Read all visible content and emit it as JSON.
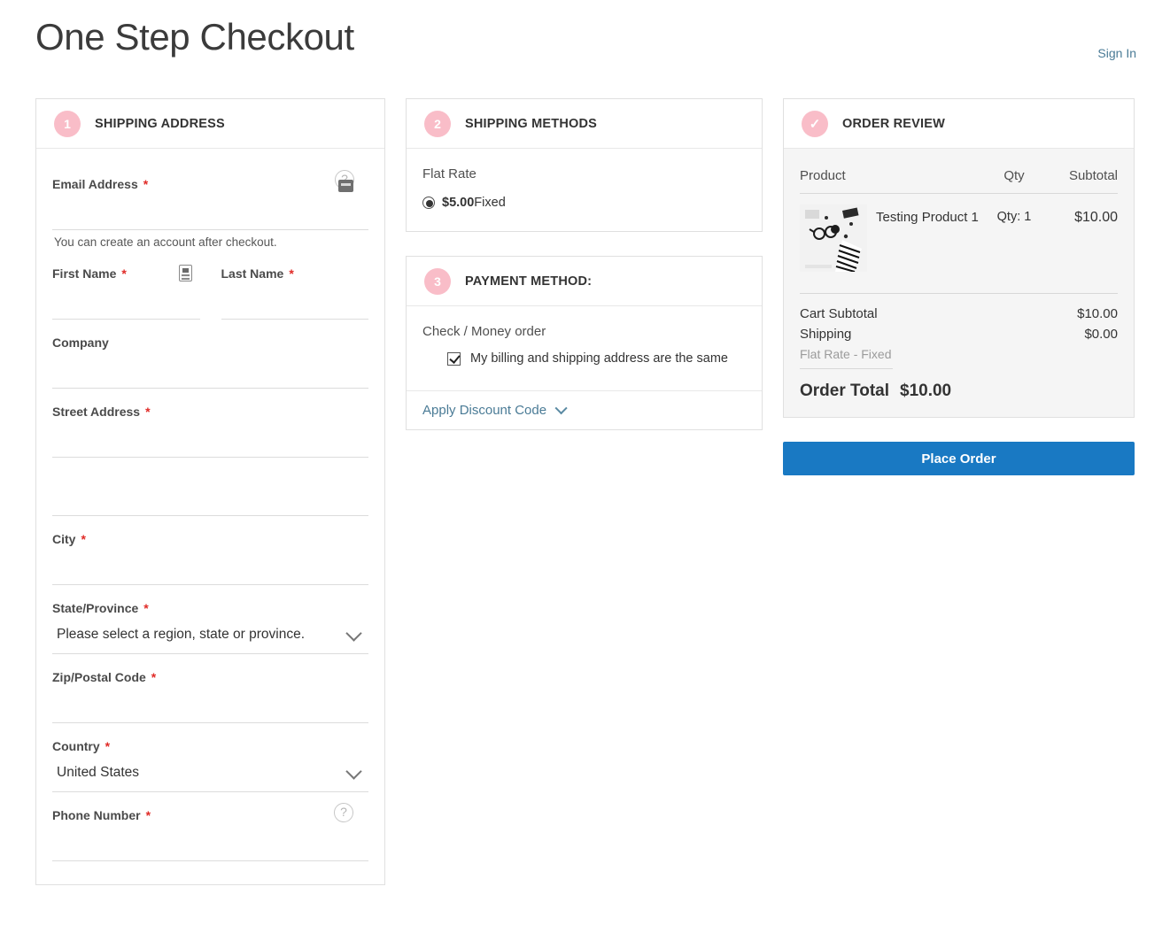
{
  "header": {
    "title": "One Step Checkout",
    "sign_in": "Sign In"
  },
  "shipping_address": {
    "step": "1",
    "title": "SHIPPING ADDRESS",
    "email": {
      "label": "Email Address",
      "required": "*",
      "value": "",
      "note": "You can create an account after checkout.",
      "help_icon": "question-circle-icon",
      "key_icon": "password-manager-icon"
    },
    "first_name": {
      "label": "First Name",
      "required": "*",
      "value": "",
      "autofill_icon": "contact-card-icon"
    },
    "last_name": {
      "label": "Last Name",
      "required": "*",
      "value": ""
    },
    "company": {
      "label": "Company",
      "required": "",
      "value": ""
    },
    "street": {
      "label": "Street Address",
      "required": "*",
      "line1": "",
      "line2": ""
    },
    "city": {
      "label": "City",
      "required": "*",
      "value": ""
    },
    "region": {
      "label": "State/Province",
      "required": "*",
      "selected": "Please select a region, state or province."
    },
    "zip": {
      "label": "Zip/Postal Code",
      "required": "*",
      "value": ""
    },
    "country": {
      "label": "Country",
      "required": "*",
      "selected": "United States"
    },
    "phone": {
      "label": "Phone Number",
      "required": "*",
      "value": "",
      "help_icon": "question-circle-icon"
    }
  },
  "shipping_methods": {
    "step": "2",
    "title": "SHIPPING METHODS",
    "carrier": "Flat Rate",
    "option_price": "$5.00",
    "option_name": "Fixed",
    "selected": true
  },
  "payment_method": {
    "step": "3",
    "title": "PAYMENT METHOD:",
    "method": "Check / Money order",
    "billing_same_label": "My billing and shipping address are the same",
    "billing_same_checked": true,
    "discount_label": "Apply Discount Code"
  },
  "order_review": {
    "step_icon": "check-icon",
    "step": "✓",
    "title": "ORDER REVIEW",
    "columns": {
      "product": "Product",
      "qty": "Qty",
      "subtotal": "Subtotal"
    },
    "items": [
      {
        "name": "Testing Product 1",
        "qty": "Qty: 1",
        "subtotal": "$10.00",
        "thumb": "product-thumbnail"
      }
    ],
    "totals": {
      "cart_subtotal_label": "Cart Subtotal",
      "cart_subtotal_value": "$10.00",
      "shipping_label": "Shipping",
      "shipping_value": "$0.00",
      "shipping_detail": "Flat Rate - Fixed",
      "order_total_label": "Order Total",
      "order_total_value": "$10.00"
    },
    "place_order": "Place Order"
  },
  "colors": {
    "step_badge": "#f9bdc8",
    "primary_button": "#1979c3",
    "link": "#4a7b96",
    "required": "#e02b27",
    "review_bg": "#f5f5f5"
  }
}
